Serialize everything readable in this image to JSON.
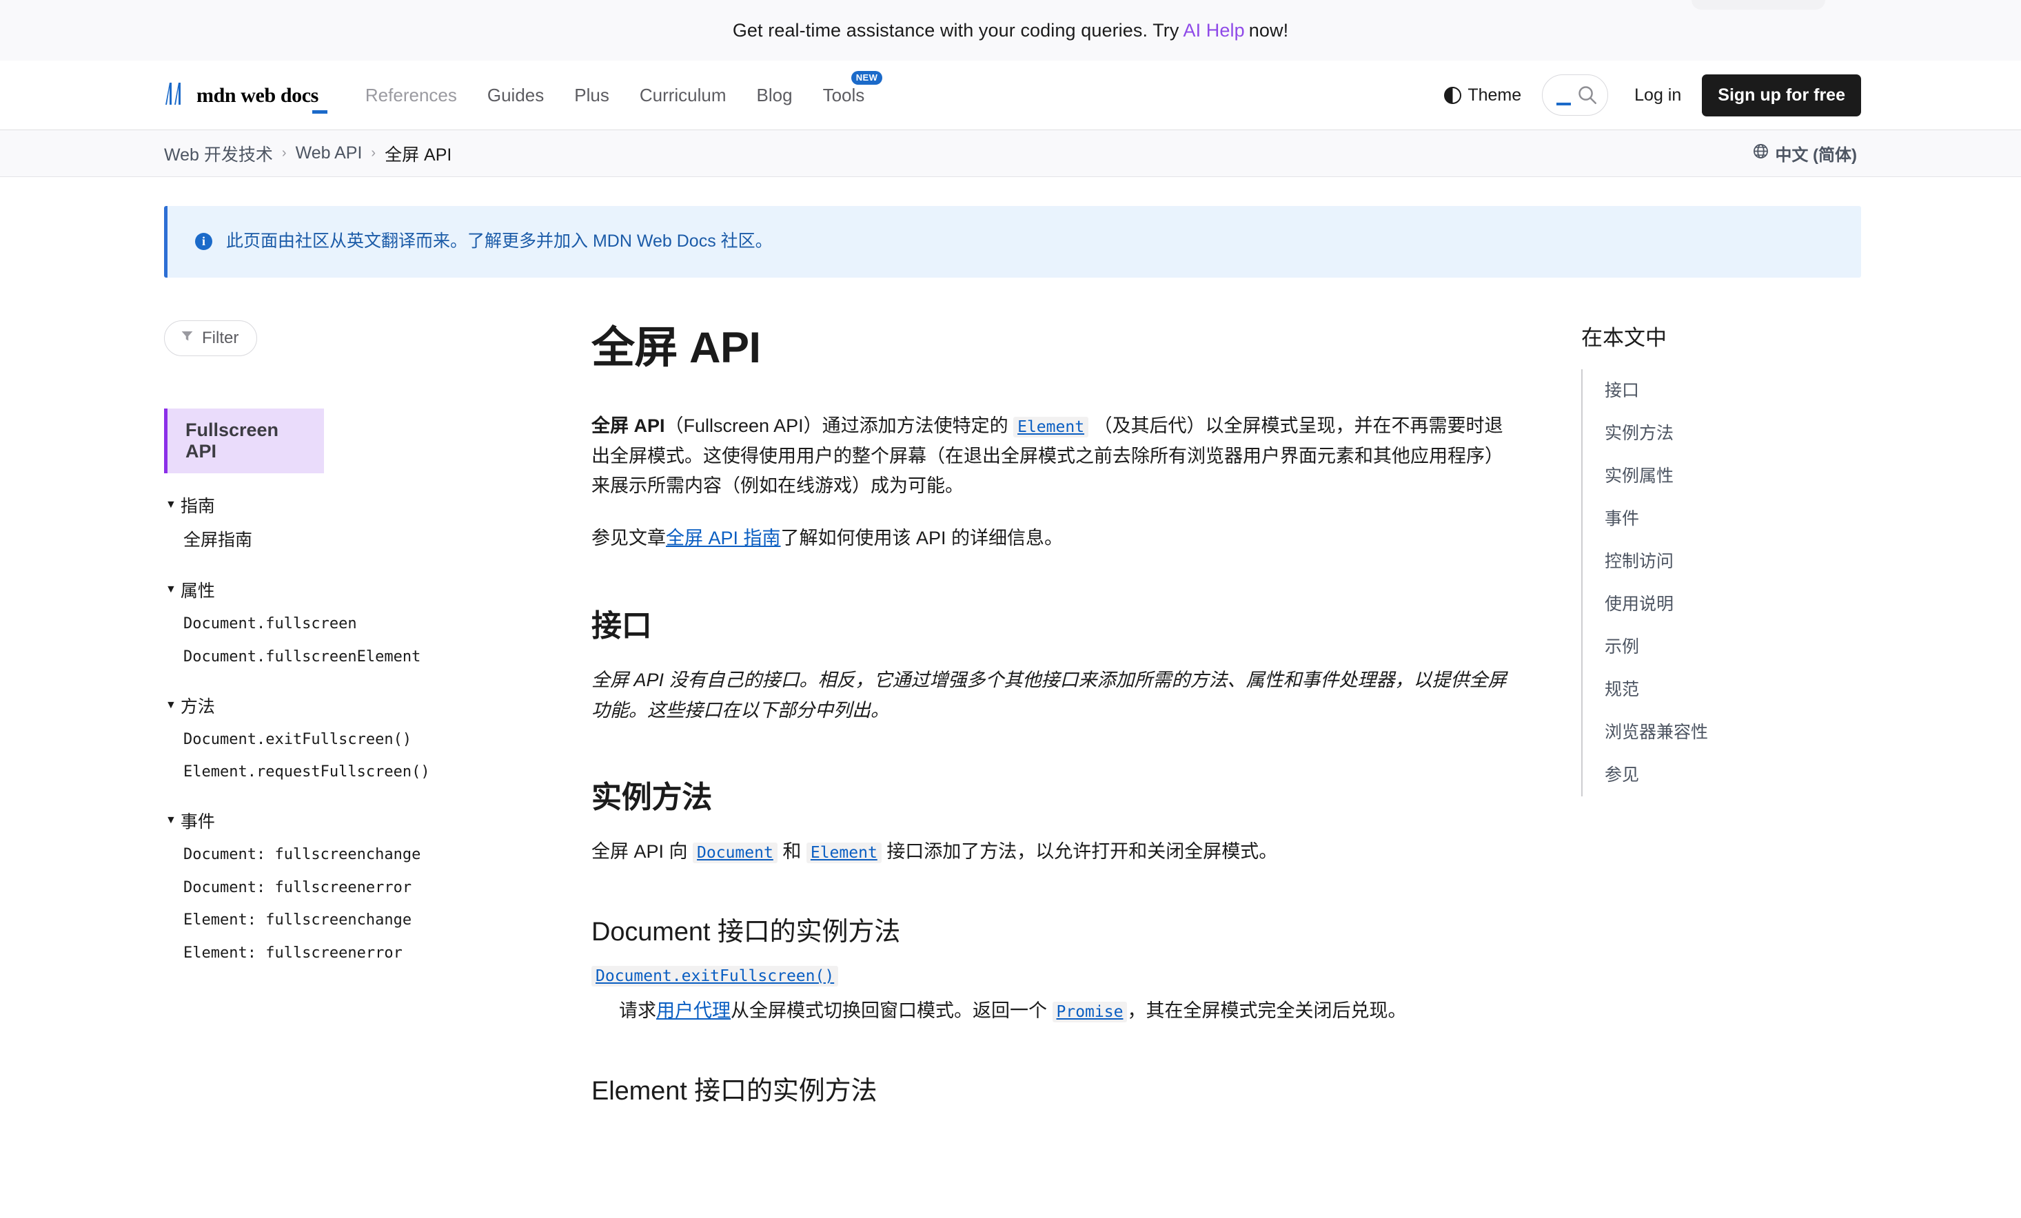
{
  "promo": {
    "text_before": "Get real-time assistance with your coding queries. Try",
    "link_label": "AI Help",
    "text_after": "now!"
  },
  "header": {
    "logo_text": "mdn web docs",
    "nav": [
      {
        "label": "References",
        "dim": true,
        "badge": null
      },
      {
        "label": "Guides",
        "dim": false,
        "badge": null
      },
      {
        "label": "Plus",
        "dim": false,
        "badge": null
      },
      {
        "label": "Curriculum",
        "dim": false,
        "badge": null
      },
      {
        "label": "Blog",
        "dim": false,
        "badge": null
      },
      {
        "label": "Tools",
        "dim": false,
        "badge": "NEW"
      }
    ],
    "theme_label": "Theme",
    "search_placeholder": "",
    "login_label": "Log in",
    "signup_label": "Sign up for free"
  },
  "breadcrumb": {
    "items": [
      {
        "label": "Web 开发技术",
        "current": false
      },
      {
        "label": "Web API",
        "current": false
      },
      {
        "label": "全屏 API",
        "current": true
      }
    ],
    "separator": "›",
    "language_label": "中文 (简体)"
  },
  "notice": {
    "text_before": "此页面由社区从英文翻译而来。",
    "link_label": "了解更多并加入 MDN Web Docs 社区",
    "text_after": "。"
  },
  "sidebar": {
    "filter_label": "Filter",
    "current_label": "Fullscreen API",
    "groups": [
      {
        "label": "指南",
        "caret": "▼",
        "items": [
          {
            "label": "全屏指南",
            "mono": false
          }
        ]
      },
      {
        "label": "属性",
        "caret": "▼",
        "items": [
          {
            "label": "Document.fullscreen",
            "mono": true
          },
          {
            "label": "Document.fullscreenElement",
            "mono": true
          }
        ]
      },
      {
        "label": "方法",
        "caret": "▼",
        "items": [
          {
            "label": "Document.exitFullscreen()",
            "mono": true
          },
          {
            "label": "Element.requestFullscreen()",
            "mono": true
          }
        ]
      },
      {
        "label": "事件",
        "caret": "▼",
        "items": [
          {
            "label": "Document: fullscreenchange",
            "mono": true
          },
          {
            "label": "Document: fullscreenerror",
            "mono": true
          },
          {
            "label": "Element: fullscreenchange",
            "mono": true
          },
          {
            "label": "Element: fullscreenerror",
            "mono": true
          }
        ]
      }
    ]
  },
  "article": {
    "title": "全屏 API",
    "intro": {
      "bold_lead": "全屏 API",
      "part1": "（Fullscreen API）通过添加方法使特定的",
      "code_link": "Element",
      "part2": "（及其后代）以全屏模式呈现，并在不再需要时退出全屏模式。这使得使用用户的整个屏幕（在退出全屏模式之前去除所有浏览器用户界面元素和其他应用程序）来展示所需内容（例如在线游戏）成为可能。"
    },
    "see_guide": {
      "part1": "参见文章",
      "link": "全屏 API 指南",
      "part2": "了解如何使用该 API 的详细信息。"
    },
    "interfaces": {
      "heading": "接口",
      "body": "全屏 API 没有自己的接口。相反，它通过增强多个其他接口来添加所需的方法、属性和事件处理器，以提供全屏功能。这些接口在以下部分中列出。"
    },
    "instance_methods": {
      "heading": "实例方法",
      "intro_part1": "全屏 API 向",
      "code_document": "Document",
      "intro_and": "和",
      "code_element": "Element",
      "intro_part2": "接口添加了方法，以允许打开和关闭全屏模式。",
      "document_heading": "Document 接口的实例方法",
      "dt_label": "Document.exitFullscreen()",
      "dd_part1": "请求",
      "dd_link": "用户代理",
      "dd_part2": "从全屏模式切换回窗口模式。返回一个",
      "dd_code": "Promise",
      "dd_part3": "，其在全屏模式完全关闭后兑现。",
      "element_heading": "Element 接口的实例方法"
    }
  },
  "toc": {
    "heading": "在本文中",
    "items": [
      "接口",
      "实例方法",
      "实例属性",
      "事件",
      "控制访问",
      "使用说明",
      "示例",
      "规范",
      "浏览器兼容性",
      "参见"
    ]
  },
  "colors": {
    "accent_purple": "#8b2fe8",
    "link_blue": "#0a5ec2",
    "promo_link": "#8f4ae8",
    "badge_blue": "#1b6ac9",
    "notice_bg": "#e9f3fd",
    "sidebar_active_bg": "#eadcfb"
  }
}
